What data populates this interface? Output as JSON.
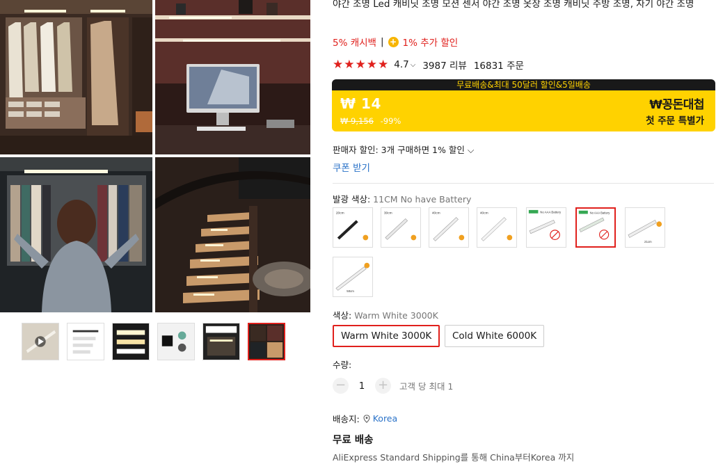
{
  "gallery": {
    "thumbnails": [
      {
        "name": "thumb-1",
        "selected": false
      },
      {
        "name": "thumb-2",
        "selected": false
      },
      {
        "name": "thumb-3",
        "selected": false
      },
      {
        "name": "thumb-4",
        "selected": false
      },
      {
        "name": "thumb-5",
        "selected": false
      },
      {
        "name": "thumb-6",
        "selected": true
      }
    ]
  },
  "product": {
    "title": "야간 조명 Led 캐비닛 조명 모션 센서 야간 조명 옷장 조명 캐비닛 주방 조명, 자기 야간 조명",
    "cashback": "5% 캐시백",
    "separator": "|",
    "extra_discount": "1% 추가 할인",
    "rating": "4.7",
    "rating_stars": 5,
    "reviews": "3987 리뷰",
    "orders": "16831 주문"
  },
  "promo": {
    "banner": "무료배송&최대 50달러 할인&5일배송",
    "price": "₩ 14",
    "old_price": "₩ 9,156",
    "discount": "-99%",
    "brand": "₩꽁돈대첩",
    "brand_sub": "첫 주문 특별가",
    "colors": {
      "bar": "#191919",
      "body": "#ffd200",
      "accent": "#e0201c"
    }
  },
  "offers": {
    "seller_discount": "판매자 할인: 3개 구매하면 1% 할인 ⌵",
    "coupon": "쿠폰 받기"
  },
  "options": {
    "emitting_color_label": "발광 색상: ",
    "emitting_color_value": "11CM No have Battery",
    "color_label": "색상: ",
    "color_value": "Warm White 3000K",
    "color_buttons": [
      "Warm White 3000K",
      "Cold White 6000K"
    ],
    "selected_color": "Warm White 3000K",
    "swatch_labels": [
      "20cm",
      "30cm",
      "40cm",
      "40cm",
      "No AAA Battery",
      "No AAA Battery",
      "21cm",
      "50cm"
    ]
  },
  "quantity": {
    "label": "수량:",
    "minus": "−",
    "plus": "+",
    "value": "1",
    "max_note": "고객 당 최대 1"
  },
  "shipping": {
    "label": "배송지:",
    "location": "Korea",
    "free": "무료 배송",
    "desc": "AliExpress Standard Shipping를 통해 China부터Korea 까지"
  },
  "icons": {
    "coin": "coin-icon",
    "star": "star-icon",
    "location": "location-pin-icon",
    "play": "play-icon"
  }
}
